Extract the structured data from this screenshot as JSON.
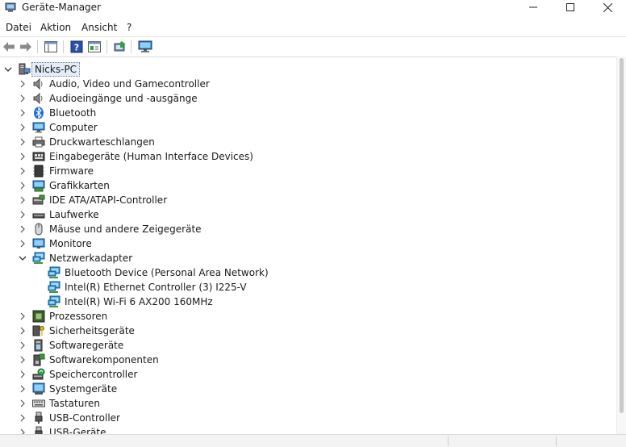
{
  "window": {
    "title": "Geräte-Manager"
  },
  "menu": {
    "items": [
      "Datei",
      "Aktion",
      "Ansicht",
      "?"
    ]
  },
  "tree": {
    "root": "Nicks-PC",
    "categories": [
      {
        "label": "Audio, Video und Gamecontroller",
        "icon": "speaker-icon"
      },
      {
        "label": "Audioeingänge und -ausgänge",
        "icon": "speaker-icon"
      },
      {
        "label": "Bluetooth",
        "icon": "bluetooth-icon"
      },
      {
        "label": "Computer",
        "icon": "monitor-icon"
      },
      {
        "label": "Druckwarteschlangen",
        "icon": "printer-icon"
      },
      {
        "label": "Eingabegeräte (Human Interface Devices)",
        "icon": "keyboard-icon"
      },
      {
        "label": "Firmware",
        "icon": "chip-icon"
      },
      {
        "label": "Grafikkarten",
        "icon": "display-adapter-icon"
      },
      {
        "label": "IDE ATA/ATAPI-Controller",
        "icon": "controller-icon"
      },
      {
        "label": "Laufwerke",
        "icon": "drive-icon"
      },
      {
        "label": "Mäuse und andere Zeigegeräte",
        "icon": "mouse-icon"
      },
      {
        "label": "Monitore",
        "icon": "monitor-icon"
      },
      {
        "label": "Netzwerkadapter",
        "icon": "network-icon",
        "expanded": true,
        "children": [
          "Bluetooth Device (Personal Area Network)",
          "Intel(R) Ethernet Controller (3) I225-V",
          "Intel(R) Wi-Fi 6 AX200 160MHz"
        ]
      },
      {
        "label": "Prozessoren",
        "icon": "processor-icon"
      },
      {
        "label": "Sicherheitsgeräte",
        "icon": "security-icon"
      },
      {
        "label": "Softwaregeräte",
        "icon": "software-device-icon"
      },
      {
        "label": "Softwarekomponenten",
        "icon": "software-component-icon"
      },
      {
        "label": "Speichercontroller",
        "icon": "storage-controller-icon"
      },
      {
        "label": "Systemgeräte",
        "icon": "system-device-icon"
      },
      {
        "label": "Tastaturen",
        "icon": "keyboard-icon"
      },
      {
        "label": "USB-Controller",
        "icon": "usb-icon"
      },
      {
        "label": "USB-Geräte",
        "icon": "usb-icon"
      }
    ]
  },
  "colors": {
    "selection": "#e3ecf7",
    "accent": "#1e6fd9",
    "network": "#2a8fd6"
  }
}
